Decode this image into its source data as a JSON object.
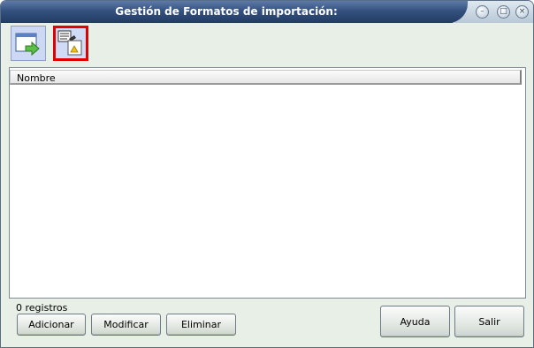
{
  "window": {
    "title": "Gestión de Formatos de importación:"
  },
  "titlebar_buttons": {
    "minimize": "–",
    "maximize": "□",
    "close": "×"
  },
  "list": {
    "column_header": "Nombre",
    "record_count": "0 registros"
  },
  "buttons": {
    "add": "Adicionar",
    "modify": "Modificar",
    "delete": "Eliminar",
    "help": "Ayuda",
    "exit": "Salir"
  },
  "colors": {
    "title_bar": "#34517f",
    "window_bg": "#e7efe7",
    "highlight_border": "#e00000"
  }
}
